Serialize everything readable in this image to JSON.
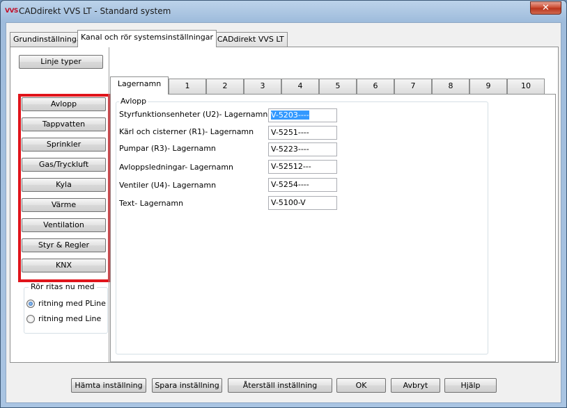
{
  "window": {
    "icon_text": "VVS",
    "title": "CADdirekt VVS LT - Standard system",
    "close_label": "✕"
  },
  "outer_tabs": [
    "Grundinställningar",
    "Kanal och rör systemsinställningar",
    "Om CADdirekt VVS LT"
  ],
  "left_panel": {
    "linje_typer": "Linje typer",
    "systems": [
      "Avlopp",
      "Tappvatten",
      "Sprinkler",
      "Gas/Tryckluft",
      "Kyla",
      "Värme",
      "Ventilation",
      "Styr & Regler",
      "KNX"
    ],
    "highlight_color": "#e0141b",
    "group_label": "Rör ritas nu med",
    "radio_pline": "ritning med PLine",
    "radio_line": "ritning med Line",
    "selected_radio": "ritning med PLine"
  },
  "inner_tabs": [
    "Lagernamn",
    "1",
    "2",
    "3",
    "4",
    "5",
    "6",
    "7",
    "8",
    "9",
    "10"
  ],
  "avlopp": {
    "group_label": "Avlopp",
    "fields": [
      {
        "label": "Styrfunktionsenheter (U2)- Lagernamn",
        "value": "V-5203----"
      },
      {
        "label": "Kärl och cisterner (R1)- Lagernamn",
        "value": "V-5251----"
      },
      {
        "label": "Pumpar (R3)- Lagernamn",
        "value": "V-5223----"
      },
      {
        "label": "Avloppsledningar- Lagernamn",
        "value": "V-52512---"
      },
      {
        "label": "Ventiler (U4)- Lagernamn",
        "value": "V-5254----"
      },
      {
        "label": "Text- Lagernamn",
        "value": "V-5100-V"
      }
    ]
  },
  "bottom_buttons": [
    "Hämta inställning",
    "Spara inställning",
    "Återställ inställning",
    "OK",
    "Avbryt",
    "Hjälp"
  ]
}
